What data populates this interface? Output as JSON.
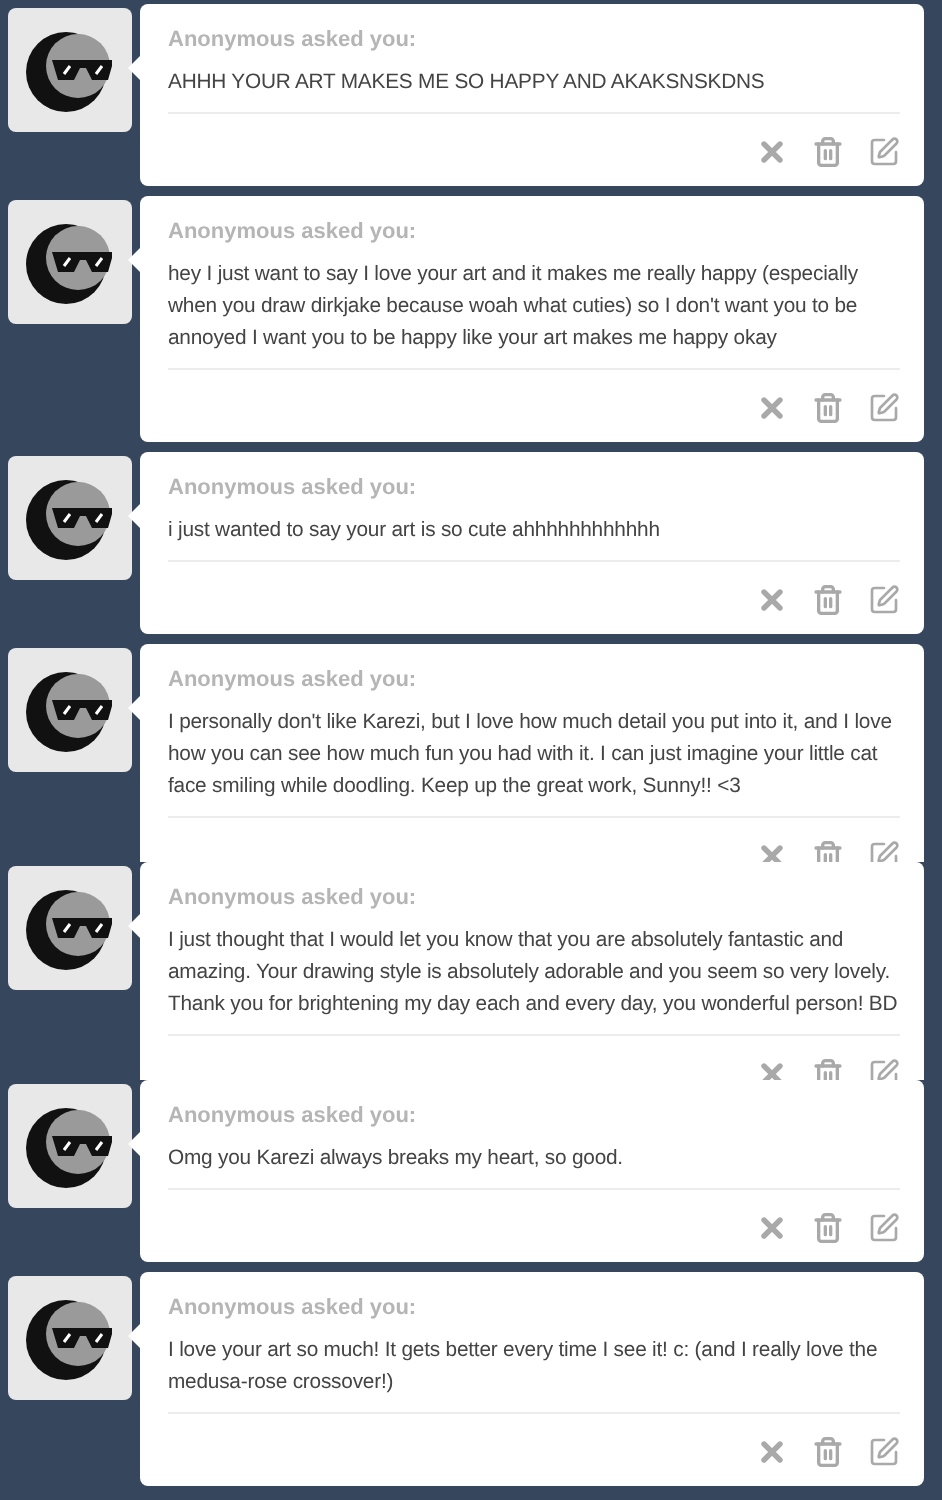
{
  "asks": [
    {
      "asker": "Anonymous asked you:",
      "question": "AHHH YOUR ART MAKES ME SO HAPPY AND AKAKSNSKDNS",
      "clipped": false
    },
    {
      "asker": "Anonymous asked you:",
      "question": "hey I just want to say I love your art and it makes me really happy (especially when you draw dirkjake because woah what cuties) so I don't want you to be annoyed I want you to be happy like your art makes me happy okay",
      "clipped": false
    },
    {
      "asker": "Anonymous asked you:",
      "question": "i just wanted to say your art is so cute ahhhhhhhhhhhh",
      "clipped": false
    },
    {
      "asker": "Anonymous asked you:",
      "question": "I personally don't like Karezi, but I love how much detail you put into it, and I love how you can see how much fun you had with it. I can just imagine your little cat face smiling while doodling. Keep up the great work, Sunny!! <3",
      "clipped": true
    },
    {
      "asker": "Anonymous asked you:",
      "question": "I just thought that I would let you know that you are absolutely fantastic and amazing. Your drawing style is absolutely adorable and you seem so very lovely. Thank you for brightening my day each and every day, you wonderful person! BD",
      "clipped": true
    },
    {
      "asker": "Anonymous asked you:",
      "question": "Omg you Karezi always breaks my heart, so good.",
      "clipped": false
    },
    {
      "asker": "Anonymous asked you:",
      "question": "I love your art so much! It gets better every time I see it! c: (and I really love the medusa-rose crossover!)",
      "clipped": false
    }
  ]
}
